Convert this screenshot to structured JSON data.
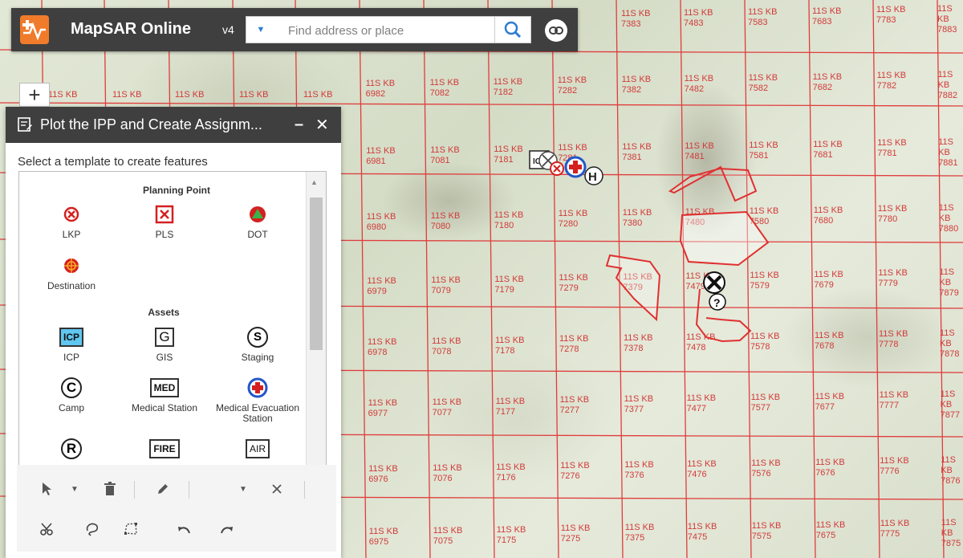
{
  "topbar": {
    "app_title": "MapSAR Online",
    "version": "v4",
    "search_placeholder": "Find address or place",
    "logo_icon": "mapsar-logo-icon",
    "accent_color": "#f07b2a"
  },
  "zoom": {
    "zoom_in_label": "+"
  },
  "panel": {
    "title": "Plot the IPP and Create Assignm...",
    "minimize_label": "–",
    "close_label": "✕",
    "subtitle": "Select a template to create features",
    "sections": [
      {
        "title": "Planning Point",
        "items": [
          {
            "label": "LKP",
            "icon": "lkp-circle-x-icon"
          },
          {
            "label": "PLS",
            "icon": "pls-box-x-icon"
          },
          {
            "label": "DOT",
            "icon": "dot-triangle-icon"
          },
          {
            "label": "Destination",
            "icon": "destination-crosshair-icon"
          }
        ]
      },
      {
        "title": "Assets",
        "items": [
          {
            "label": "ICP",
            "icon": "icp-box-icon",
            "text": "ICP"
          },
          {
            "label": "GIS",
            "icon": "gis-box-icon",
            "text": "G"
          },
          {
            "label": "Staging",
            "icon": "staging-circle-icon",
            "text": "S"
          },
          {
            "label": "Camp",
            "icon": "camp-circle-icon",
            "text": "C"
          },
          {
            "label": "Medical Station",
            "icon": "med-box-icon",
            "text": "MED"
          },
          {
            "label": "Medical Evacuation Station",
            "icon": "medevac-cross-icon"
          },
          {
            "label": "",
            "icon": "r-circle-icon",
            "text": "R"
          },
          {
            "label": "",
            "icon": "fire-box-icon",
            "text": "FIRE"
          },
          {
            "label": "",
            "icon": "air-box-icon",
            "text": "AIR"
          }
        ]
      }
    ]
  },
  "grid": {
    "prefix": "11S KB",
    "map_marker_labels": [
      "H",
      "?"
    ],
    "line_color": "#e03c3c",
    "label_color": "#d23a3a",
    "columns": [
      "69",
      "70",
      "71",
      "72",
      "73",
      "74",
      "75",
      "76",
      "77",
      "78"
    ],
    "rows": [
      "83",
      "82",
      "81",
      "80",
      "79",
      "78",
      "77",
      "76",
      "75"
    ],
    "row_left_codes": [
      "KB",
      "KB",
      "KB",
      "KB",
      "KB"
    ],
    "left_row_values": [
      "6982",
      "7082",
      "7182",
      "7282"
    ],
    "top_row_values": [
      "7383",
      "7483",
      "7583",
      "7683",
      "7783",
      "7883"
    ]
  }
}
